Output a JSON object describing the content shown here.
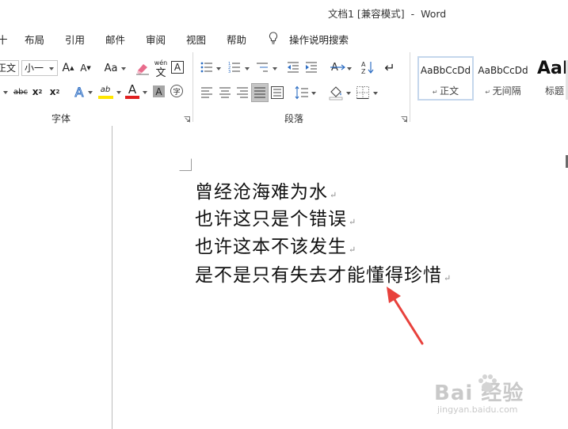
{
  "window": {
    "title": "文档1 [兼容模式]  -  Word"
  },
  "tabs": [
    "布局",
    "引用",
    "邮件",
    "审阅",
    "视图",
    "帮助"
  ],
  "tell_me": "操作说明搜索",
  "font_group": {
    "label": "字体",
    "font_name": "正文",
    "font_size": "小一",
    "change_case": "Aa",
    "strikethrough": "abc",
    "phonetic_top": "wén",
    "phonetic_bottom": "文",
    "char_border": "A",
    "text_effect": "A",
    "highlight": "ab",
    "font_color": "A",
    "char_shade": "A",
    "enclose": "字"
  },
  "paragraph_group": {
    "label": "段落",
    "sort_label": "A↓",
    "pilcrow": "↵"
  },
  "styles": [
    {
      "preview": "AaBbCcDd",
      "name": "正文",
      "selected": true
    },
    {
      "preview": "AaBbCcDd",
      "name": "无间隔",
      "selected": false
    },
    {
      "preview": "AaB",
      "name": "标题",
      "selected": false
    }
  ],
  "document": {
    "lines": [
      "曾经沧海难为水",
      "也许这只是个错误",
      "也许这本不该发生",
      "是不是只有失去才能懂得珍惜"
    ],
    "paragraph_mark": "↵"
  },
  "watermark": {
    "logo": "Bai 经验",
    "url": "jingyan.baidu.com"
  },
  "colors": {
    "accent": "#2b579a",
    "highlight_yellow": "#ffe600",
    "font_red": "#e02020",
    "arrow": "#e8413c",
    "selected_style": "#c5d7ec"
  }
}
